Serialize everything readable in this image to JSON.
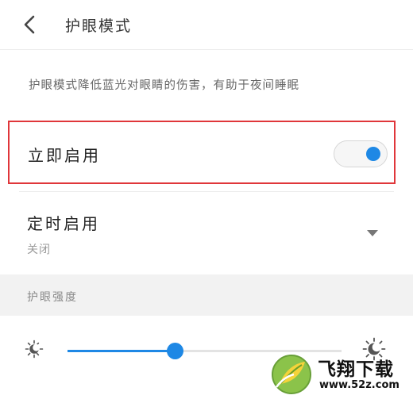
{
  "header": {
    "title": "护眼模式"
  },
  "description": "护眼模式降低蓝光对眼睛的伤害，有助于夜间睡眠",
  "immediate": {
    "label": "立即启用",
    "enabled": true
  },
  "scheduled": {
    "label": "定时启用",
    "value": "关闭"
  },
  "strength": {
    "section_label": "护眼强度",
    "level": 0.39
  },
  "colors": {
    "accent": "#1e88e5",
    "highlight_border": "#e0363a"
  },
  "watermark": {
    "name": "飞翔下载",
    "url": "www.52z.com"
  }
}
